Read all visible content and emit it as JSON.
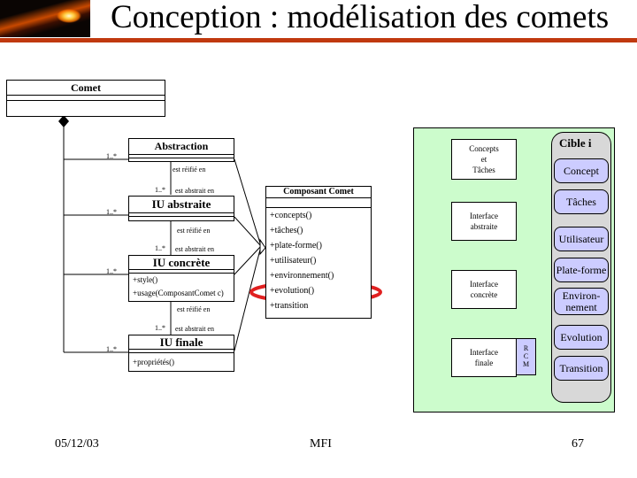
{
  "header": {
    "title": "Conception : modélisation des comets",
    "logo": "comet-image"
  },
  "uml": {
    "comet_class": {
      "name": "Comet"
    },
    "classes": [
      {
        "name": "Abstraction",
        "operations": []
      },
      {
        "name": "IU abstraite",
        "operations": []
      },
      {
        "name": "IU concrète",
        "operations": [
          "+style()",
          "+usage(ComposantComet c)"
        ]
      },
      {
        "name": "IU finale",
        "operations": [
          "+propriétés()"
        ]
      }
    ],
    "multiplicity": "1..*",
    "reification_label": "est réifié en",
    "abstraction_label": "est abstrait en",
    "component_class": {
      "name": "Composant Comet",
      "operations": [
        "+concepts()",
        "+tâches()",
        "+plate-forme()",
        "+utilisateur()",
        "+environnement()",
        "+evolution()",
        "+transition"
      ],
      "highlighted_operation": "+evolution()"
    },
    "highlight_color": "#e02020"
  },
  "framework": {
    "levels": [
      {
        "label_lines": [
          "Concepts",
          "et",
          "Tâches"
        ]
      },
      {
        "label_lines": [
          "Interface",
          "abstraite"
        ]
      },
      {
        "label_lines": [
          "Interface",
          "concrète"
        ]
      },
      {
        "label_lines": [
          "Interface",
          "finale"
        ]
      }
    ],
    "rcm_lines": [
      "R",
      "C",
      "M"
    ],
    "target": {
      "title": "Cible i",
      "items": [
        "Concept",
        "Tâches",
        "Utilisateur",
        "Plate-forme",
        "Environ-\nnement",
        "Evolution",
        "Transition"
      ]
    },
    "colors": {
      "panel": "#ccfccc",
      "target_bg": "#d8d8d8",
      "pill": "#ccccff"
    }
  },
  "footer": {
    "date": "05/12/03",
    "center": "MFI",
    "page": "67"
  }
}
